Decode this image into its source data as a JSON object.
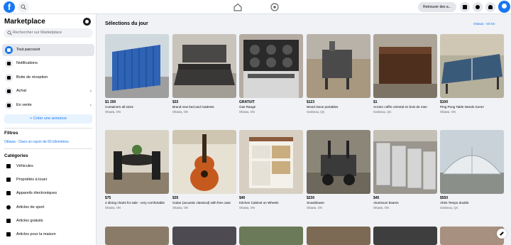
{
  "topbar": {
    "logo": "f",
    "find_friends": "Retrouver des a...",
    "icons": [
      "facebook-logo",
      "search-icon",
      "home-icon",
      "marketplace-icon",
      "menu-grid-icon",
      "messenger-icon",
      "notifications-icon",
      "account-avatar"
    ]
  },
  "sidebar": {
    "title": "Marketplace",
    "search_placeholder": "Rechercher sur Marketplace",
    "items": [
      {
        "label": "Tout parcourir",
        "icon": "shop-icon"
      },
      {
        "label": "Notifications",
        "icon": "bell-icon"
      },
      {
        "label": "Boite de réception",
        "icon": "inbox-icon"
      },
      {
        "label": "Achat",
        "icon": "bag-icon"
      },
      {
        "label": "En vente",
        "icon": "tag-icon"
      }
    ],
    "create_button": "+ Créer une annonce",
    "filters_heading": "Filtres",
    "filter_location": "Ottawa · Dans un rayon de 60 kilomètres",
    "categories_heading": "Catégories",
    "categories": [
      {
        "label": "Véhicules",
        "icon": "car-icon"
      },
      {
        "label": "Propriétés à louer",
        "icon": "house-icon"
      },
      {
        "label": "Appareils électroniques",
        "icon": "phone-icon"
      },
      {
        "label": "Articles de sport",
        "icon": "ball-icon"
      },
      {
        "label": "Articles gratuits",
        "icon": "gift-icon"
      },
      {
        "label": "Articles pour la maison",
        "icon": "sofa-icon"
      }
    ]
  },
  "main": {
    "title": "Sélections du jour",
    "location": "Ottawa · 60 km",
    "row1": [
      {
        "price": "$1 200",
        "title": "Containers all sizes",
        "city": "Ottawa, ON"
      },
      {
        "price": "$33",
        "title": "Brand new bed and mattress",
        "city": "Ottawa, ON"
      },
      {
        "price": "GRATUIT",
        "title": "Gas Range",
        "city": "Ottawa, ON"
      },
      {
        "price": "$123",
        "title": "Wood stove portables",
        "city": "Gatineau, QC"
      },
      {
        "price": "$1",
        "title": "Ancien coffre oriental en bois de rose",
        "city": "Gatineau, QC"
      },
      {
        "price": "$100",
        "title": "Ping Pong Table Needs Gone!",
        "city": "Ottawa, ON"
      }
    ],
    "row2": [
      {
        "price": "$75",
        "title": "4 dining chairs for sale - very comfortable",
        "city": "Ottawa, ON"
      },
      {
        "price": "$35",
        "title": "Guitar (acoustic classical) with free case",
        "city": "Ottawa, ON"
      },
      {
        "price": "$40",
        "title": "Kitchen Cabinet on Wheels",
        "city": "Ottawa, ON"
      },
      {
        "price": "$230",
        "title": "Snowblower",
        "city": "Ottawa, ON"
      },
      {
        "price": "$45",
        "title": "Aluminum beams",
        "city": "Ottawa, ON"
      },
      {
        "price": "$550",
        "title": "Abris Tempo double",
        "city": "Gatineau, QC"
      }
    ]
  },
  "colors": {
    "accent": "#1877f2",
    "background": "#f0f2f5"
  }
}
